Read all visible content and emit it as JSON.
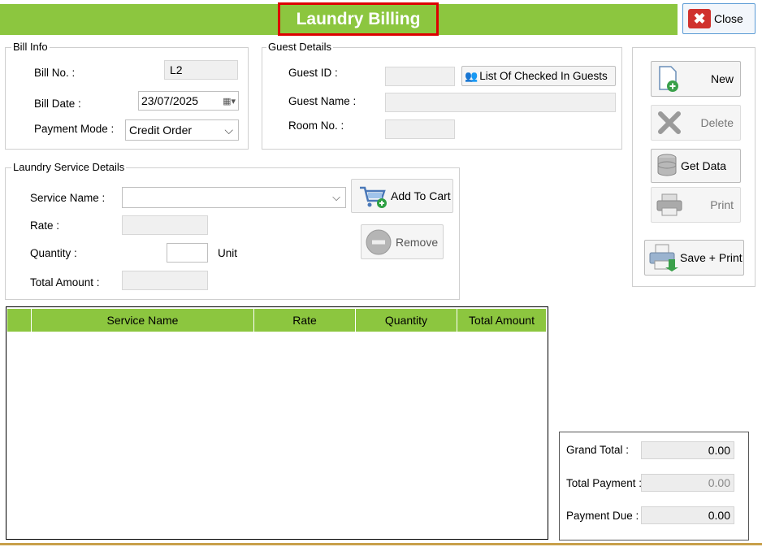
{
  "window": {
    "title": "Laundry Billing",
    "close_label": "Close"
  },
  "bill_info": {
    "legend": "Bill Info",
    "bill_no_label": "Bill No. :",
    "bill_no_value": "L2",
    "bill_date_label": "Bill Date :",
    "bill_date_value": "23/07/2025",
    "payment_mode_label": "Payment Mode :",
    "payment_mode_value": "Credit Order"
  },
  "guest_details": {
    "legend": "Guest Details",
    "guest_id_label": "Guest ID :",
    "guest_id_value": "",
    "list_button": "List Of Checked In Guests",
    "guest_name_label": "Guest Name :",
    "guest_name_value": "",
    "room_no_label": "Room No. :",
    "room_no_value": ""
  },
  "service": {
    "legend": "Laundry Service Details",
    "service_name_label": "Service Name :",
    "service_name_value": "",
    "rate_label": "Rate :",
    "rate_value": "",
    "quantity_label": "Quantity :",
    "quantity_value": "",
    "unit_label": "Unit",
    "total_amount_label": "Total Amount :",
    "total_amount_value": "",
    "add_to_cart": "Add To Cart",
    "remove": "Remove"
  },
  "actions": {
    "new": "New",
    "delete": "Delete",
    "get_data": "Get Data",
    "print": "Print",
    "save_print": "Save + Print"
  },
  "grid": {
    "columns": [
      "",
      "Service Name",
      "Rate",
      "Quantity",
      "Total Amount"
    ],
    "rows": []
  },
  "totals": {
    "grand_total_label": "Grand Total :",
    "grand_total_value": "0.00",
    "total_payment_label": "Total Payment :",
    "total_payment_value": "0.00",
    "payment_due_label": "Payment Due :",
    "payment_due_value": "0.00"
  },
  "colors": {
    "accent": "#8cc63f",
    "title_border": "#dd0000"
  }
}
